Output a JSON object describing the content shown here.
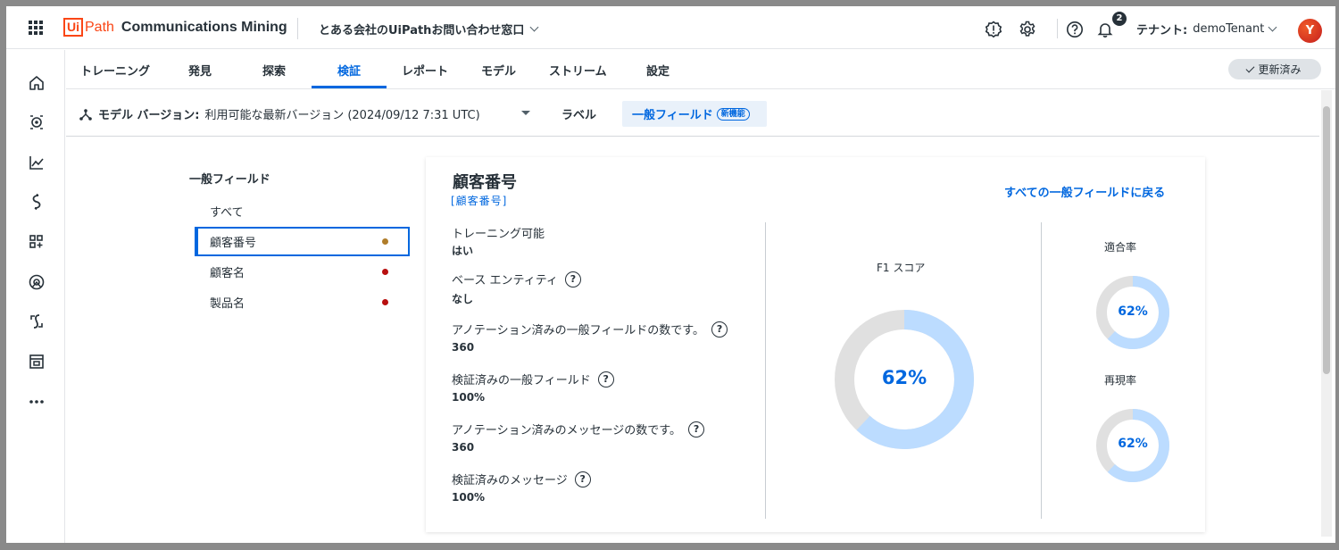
{
  "app": {
    "logo_ui": "Ui",
    "logo_path": "Path",
    "product": "Communications Mining",
    "project": "とある会社のUiPathお問い合わせ窓口",
    "notification_count": "2",
    "tenant_label": "テナント:",
    "tenant_name": "demoTenant",
    "avatar_initial": "Y",
    "brand_color": "#fa4616",
    "accent_color": "#0067df"
  },
  "icons": {
    "topbar": [
      "alert-icon",
      "gear-icon",
      "help-icon",
      "bell-icon"
    ],
    "sidenav": [
      "home-icon",
      "dataset-icon",
      "chart-icon",
      "streams-icon",
      "apps-icon",
      "explore-icon",
      "integrations-icon",
      "archive-icon",
      "more-icon"
    ]
  },
  "tabs": {
    "items": [
      "トレーニング",
      "発見",
      "探索",
      "検証",
      "レポート",
      "モデル",
      "ストリーム",
      "設定"
    ],
    "active": "検証",
    "updated_label": "更新済み"
  },
  "subbar": {
    "model_version_label": "モデル バージョン:",
    "model_version_value": "利用可能な最新バージョン (2024/09/12 7:31 UTC)",
    "labels_tab": "ラベル",
    "fields_tab": "一般フィールド",
    "new_badge": "新機能"
  },
  "left_panel": {
    "title": "一般フィールド",
    "all": "すべて",
    "items": [
      {
        "name": "顧客番号",
        "dot_color": "#b07d2a",
        "selected": true
      },
      {
        "name": "顧客名",
        "dot_color": "#b80f0f",
        "selected": false
      },
      {
        "name": "製品名",
        "dot_color": "#b80f0f",
        "selected": false
      }
    ]
  },
  "detail": {
    "title": "顧客番号",
    "tag": "[顧客番号]",
    "back_link": "すべての一般フィールドに戻る",
    "stats": [
      {
        "label": "トレーニング可能",
        "value": "はい",
        "help": false
      },
      {
        "label": "ベース エンティティ",
        "value": "なし",
        "help": true
      },
      {
        "label": "アノテーション済みの一般フィールドの数です。",
        "value": "360",
        "help": true
      },
      {
        "label": "検証済みの一般フィールド",
        "value": "100%",
        "help": true
      },
      {
        "label": "アノテーション済みのメッセージの数です。",
        "value": "360",
        "help": true
      },
      {
        "label": "検証済みのメッセージ",
        "value": "100%",
        "help": true
      }
    ],
    "f1_label": "F1 スコア",
    "f1_value": 0.62,
    "f1_text": "62%",
    "precision_label": "適合率",
    "precision_value": 0.62,
    "precision_text": "62%",
    "recall_label": "再現率",
    "recall_value": 0.62,
    "recall_text": "62%",
    "donut_fill_color": "#bcdcff",
    "donut_track_color": "#e0e0e0"
  }
}
